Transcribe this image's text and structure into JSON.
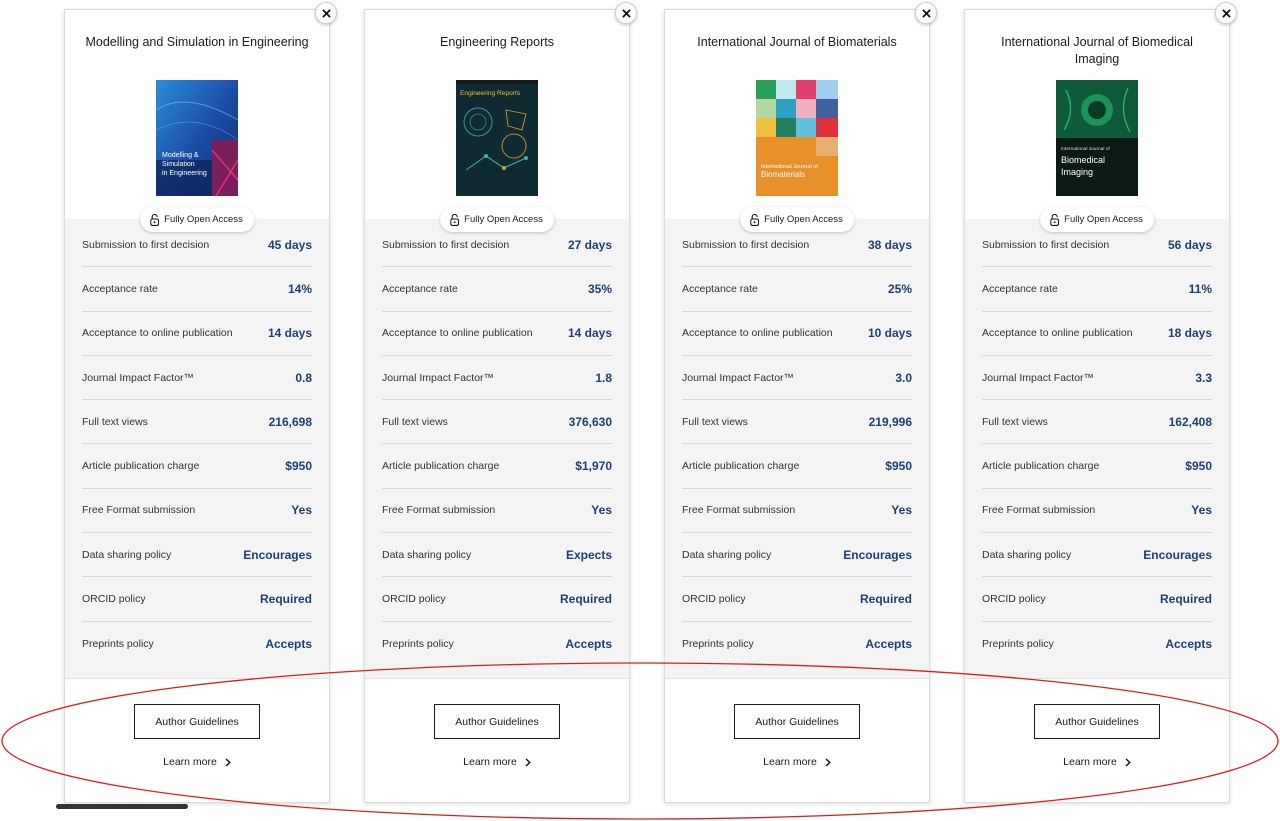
{
  "badge_label": "Fully Open Access",
  "guidelines_label": "Author Guidelines",
  "learn_more_label": "Learn more",
  "colors": {
    "value": "#1d3f73",
    "annotation": "#d62020"
  },
  "cards": [
    {
      "title": "Modelling and Simulation in Engineering",
      "cover_text": [
        "Modelling &",
        "Simulation",
        "in Engineering"
      ],
      "metrics": [
        {
          "label": "Submission to first decision",
          "value": "45 days"
        },
        {
          "label": "Acceptance rate",
          "value": "14%"
        },
        {
          "label": "Acceptance to online publication",
          "value": "14 days"
        },
        {
          "label": "Journal Impact Factor™",
          "value": "0.8"
        },
        {
          "label": "Full text views",
          "value": "216,698"
        },
        {
          "label": "Article publication charge",
          "value": "$950"
        },
        {
          "label": "Free Format submission",
          "value": "Yes"
        },
        {
          "label": "Data sharing policy",
          "value": "Encourages"
        },
        {
          "label": "ORCID policy",
          "value": "Required"
        },
        {
          "label": "Preprints policy",
          "value": "Accepts"
        }
      ]
    },
    {
      "title": "Engineering Reports",
      "cover_text": [
        "Engineering Reports"
      ],
      "metrics": [
        {
          "label": "Submission to first decision",
          "value": "27 days"
        },
        {
          "label": "Acceptance rate",
          "value": "35%"
        },
        {
          "label": "Acceptance to online publication",
          "value": "14 days"
        },
        {
          "label": "Journal Impact Factor™",
          "value": "1.8"
        },
        {
          "label": "Full text views",
          "value": "376,630"
        },
        {
          "label": "Article publication charge",
          "value": "$1,970"
        },
        {
          "label": "Free Format submission",
          "value": "Yes"
        },
        {
          "label": "Data sharing policy",
          "value": "Expects"
        },
        {
          "label": "ORCID policy",
          "value": "Required"
        },
        {
          "label": "Preprints policy",
          "value": "Accepts"
        }
      ]
    },
    {
      "title": "International Journal of Biomaterials",
      "cover_text": [
        "International Journal of",
        "Biomaterials"
      ],
      "metrics": [
        {
          "label": "Submission to first decision",
          "value": "38 days"
        },
        {
          "label": "Acceptance rate",
          "value": "25%"
        },
        {
          "label": "Acceptance to online publication",
          "value": "10 days"
        },
        {
          "label": "Journal Impact Factor™",
          "value": "3.0"
        },
        {
          "label": "Full text views",
          "value": "219,996"
        },
        {
          "label": "Article publication charge",
          "value": "$950"
        },
        {
          "label": "Free Format submission",
          "value": "Yes"
        },
        {
          "label": "Data sharing policy",
          "value": "Encourages"
        },
        {
          "label": "ORCID policy",
          "value": "Required"
        },
        {
          "label": "Preprints policy",
          "value": "Accepts"
        }
      ]
    },
    {
      "title": "International Journal of Biomedical Imaging",
      "cover_text": [
        "International Journal of",
        "Biomedical",
        "Imaging"
      ],
      "metrics": [
        {
          "label": "Submission to first decision",
          "value": "56 days"
        },
        {
          "label": "Acceptance rate",
          "value": "11%"
        },
        {
          "label": "Acceptance to online publication",
          "value": "18 days"
        },
        {
          "label": "Journal Impact Factor™",
          "value": "3.3"
        },
        {
          "label": "Full text views",
          "value": "162,408"
        },
        {
          "label": "Article publication charge",
          "value": "$950"
        },
        {
          "label": "Free Format submission",
          "value": "Yes"
        },
        {
          "label": "Data sharing policy",
          "value": "Encourages"
        },
        {
          "label": "ORCID policy",
          "value": "Required"
        },
        {
          "label": "Preprints policy",
          "value": "Accepts"
        }
      ]
    }
  ]
}
